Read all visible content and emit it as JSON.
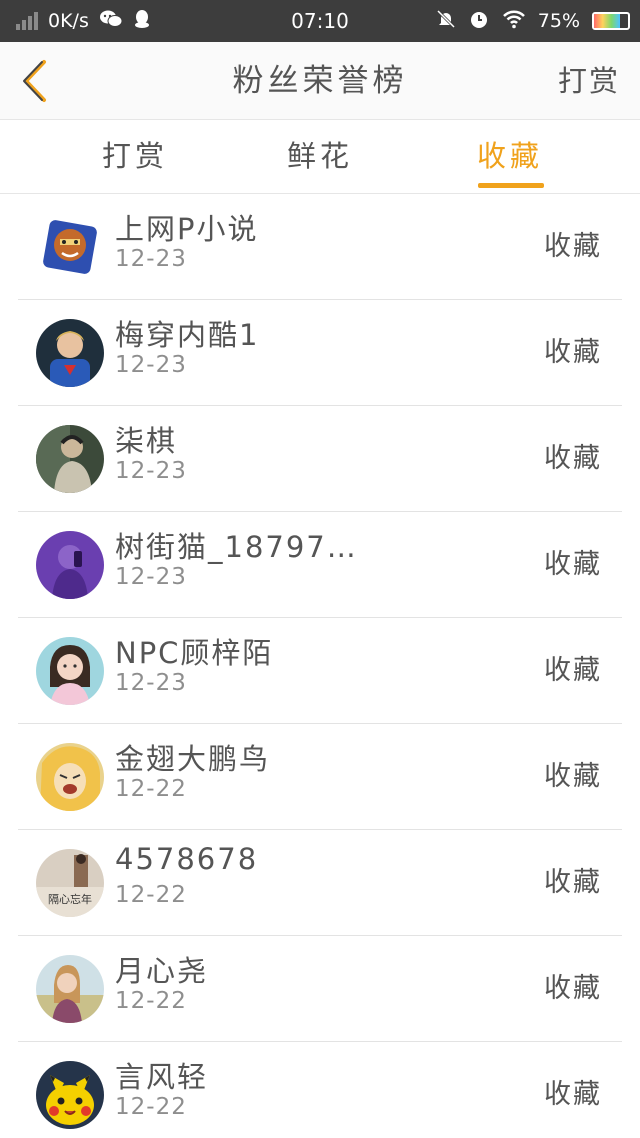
{
  "status_bar": {
    "speed": "0K/s",
    "time": "07:10",
    "battery": "75%",
    "icons": [
      "signal-icon",
      "wechat-icon",
      "qq-icon",
      "mute-icon",
      "alarm-icon",
      "wifi-icon",
      "battery-icon"
    ]
  },
  "header": {
    "title": "粉丝荣誉榜",
    "action_label": "打赏",
    "back_icon": "chevron-left-icon"
  },
  "colors": {
    "accent": "#f0a21c",
    "text": "#555555",
    "subtext": "#8e8e8e"
  },
  "tabs": [
    {
      "label": "打赏",
      "active": false
    },
    {
      "label": "鲜花",
      "active": false
    },
    {
      "label": "收藏",
      "active": true
    }
  ],
  "fans": [
    {
      "name": "上网P小说",
      "date": "12-23",
      "action": "收藏",
      "avatar": "cartoon-character-avatar"
    },
    {
      "name": "梅穿内酷1",
      "date": "12-23",
      "action": "收藏",
      "avatar": "child-photo-avatar"
    },
    {
      "name": "柒棋",
      "date": "12-23",
      "action": "收藏",
      "avatar": "person-photo-avatar"
    },
    {
      "name": "树街猫_18797…",
      "date": "12-23",
      "action": "收藏",
      "avatar": "purple-photo-avatar"
    },
    {
      "name": "NPC顾梓陌",
      "date": "12-23",
      "action": "收藏",
      "avatar": "girl-photo-avatar"
    },
    {
      "name": "金翅大鹏鸟",
      "date": "12-22",
      "action": "收藏",
      "avatar": "anime-face-avatar"
    },
    {
      "name": "4578678",
      "date": "12-22",
      "action": "收藏",
      "avatar": "text-photo-avatar",
      "avatar_text": "隔心忘年"
    },
    {
      "name": "月心尧",
      "date": "12-22",
      "action": "收藏",
      "avatar": "girl-outdoor-avatar"
    },
    {
      "name": "言风轻",
      "date": "12-22",
      "action": "收藏",
      "avatar": "pikachu-avatar"
    }
  ]
}
